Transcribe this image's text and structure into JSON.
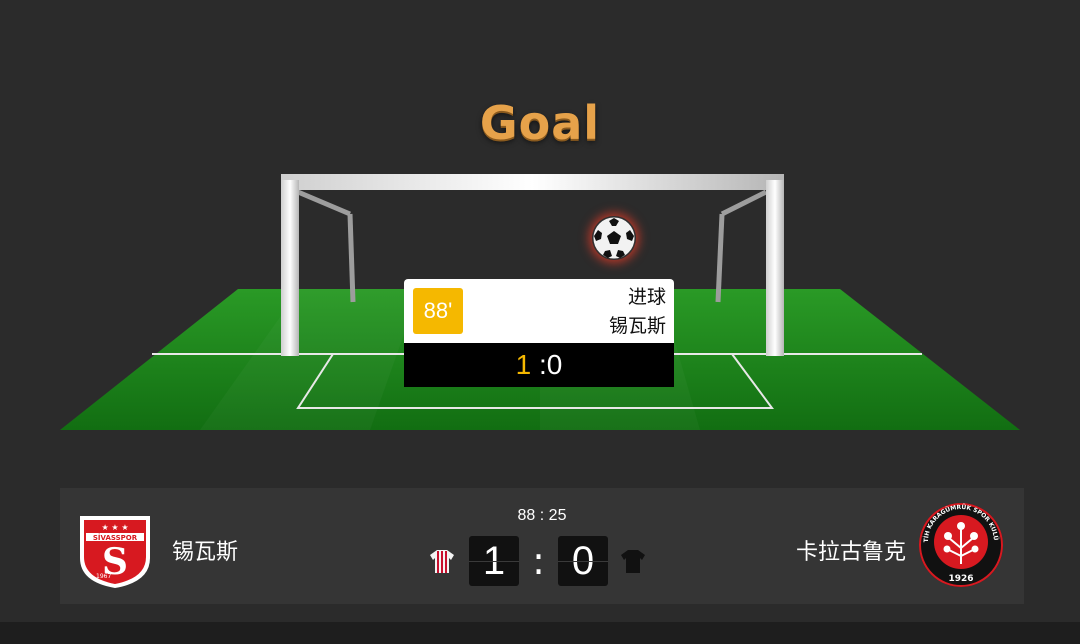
{
  "banner": {
    "title": "Goal"
  },
  "event": {
    "minute": "88'",
    "type": "进球",
    "team": "锡瓦斯",
    "score_home": "1",
    "score_sep": " :",
    "score_away": "0"
  },
  "match": {
    "clock": "88 : 25",
    "home": {
      "name": "锡瓦斯",
      "score": "1",
      "logo_text_top": "SİVASSPOR",
      "logo_year": "1967",
      "kit_color": "#c8102e"
    },
    "away": {
      "name": "卡拉古鲁克",
      "score": "0",
      "logo_text_ring": "FATİH KARAGÜMRÜK SPOR KULÜBÜ",
      "logo_year": "1926",
      "kit_color": "#111111"
    },
    "separator": ":"
  },
  "colors": {
    "background": "#2b2b2b",
    "pitch": "#1e8a1e",
    "accent": "#f5b800",
    "title": "#e6a24a"
  },
  "icons": {
    "ball": "soccer-ball-icon",
    "home_kit": "striped-jersey-icon",
    "away_kit": "black-jersey-icon"
  }
}
